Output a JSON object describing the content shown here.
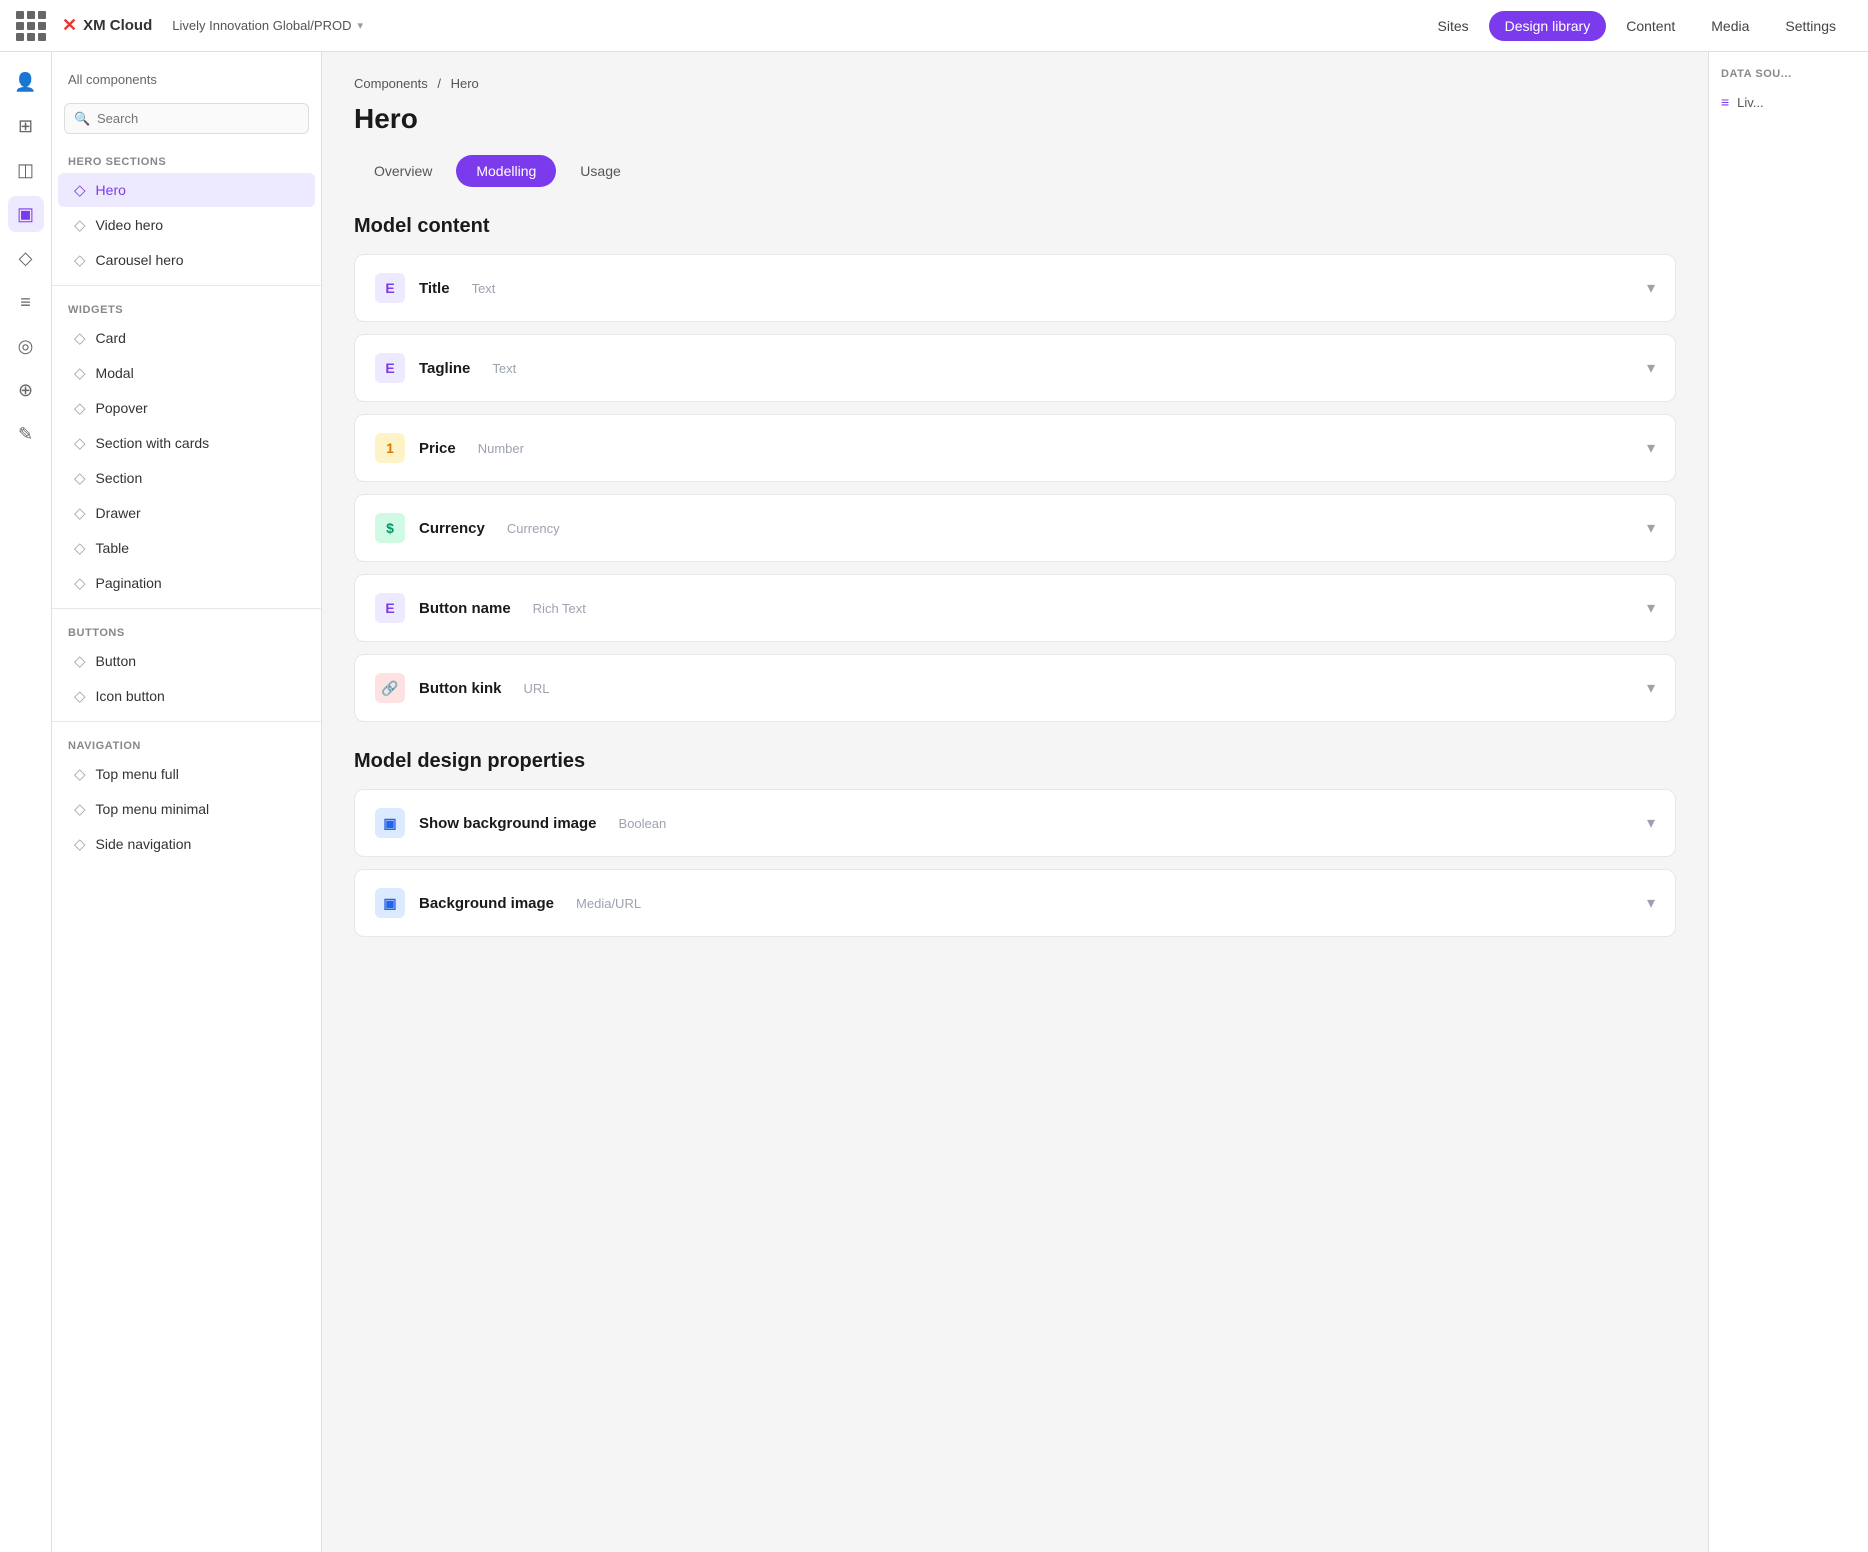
{
  "topnav": {
    "grid_label": "apps-grid",
    "logo_text": "XM Cloud",
    "brand": "Lively Innovation Global/PROD",
    "links": [
      {
        "label": "Sites",
        "active": false
      },
      {
        "label": "Design library",
        "active": true
      },
      {
        "label": "Content",
        "active": false
      },
      {
        "label": "Media",
        "active": false
      },
      {
        "label": "Settings",
        "active": false
      }
    ]
  },
  "icon_sidebar": {
    "items": [
      {
        "icon": "👤",
        "name": "profile-icon",
        "active": false
      },
      {
        "icon": "⊞",
        "name": "grid-icon",
        "active": false
      },
      {
        "icon": "◫",
        "name": "layout-icon",
        "active": false
      },
      {
        "icon": "▣",
        "name": "components-icon",
        "active": true
      },
      {
        "icon": "◇",
        "name": "diamond-icon",
        "active": false
      },
      {
        "icon": "≡",
        "name": "list-icon",
        "active": false
      },
      {
        "icon": "◎",
        "name": "globe-icon",
        "active": false
      },
      {
        "icon": "⊕",
        "name": "add-icon",
        "active": false
      },
      {
        "icon": "✎",
        "name": "edit-icon",
        "active": false
      }
    ]
  },
  "comp_sidebar": {
    "all_components_label": "All components",
    "search_placeholder": "Search",
    "sections": [
      {
        "label": "HERO SECTIONS",
        "items": [
          {
            "label": "Hero",
            "active": true
          },
          {
            "label": "Video hero",
            "active": false
          },
          {
            "label": "Carousel hero",
            "active": false
          }
        ]
      },
      {
        "label": "WIDGETS",
        "items": [
          {
            "label": "Card",
            "active": false
          },
          {
            "label": "Modal",
            "active": false
          },
          {
            "label": "Popover",
            "active": false
          },
          {
            "label": "Section with cards",
            "active": false
          },
          {
            "label": "Section",
            "active": false
          },
          {
            "label": "Drawer",
            "active": false
          },
          {
            "label": "Table",
            "active": false
          },
          {
            "label": "Pagination",
            "active": false
          }
        ]
      },
      {
        "label": "BUTTONS",
        "items": [
          {
            "label": "Button",
            "active": false
          },
          {
            "label": "Icon button",
            "active": false
          }
        ]
      },
      {
        "label": "NAVIGATION",
        "items": [
          {
            "label": "Top menu full",
            "active": false
          },
          {
            "label": "Top menu minimal",
            "active": false
          },
          {
            "label": "Side navigation",
            "active": false
          }
        ]
      }
    ]
  },
  "breadcrumb": {
    "parent": "Components",
    "current": "Hero"
  },
  "page_title": "Hero",
  "tabs": [
    {
      "label": "Overview",
      "active": false
    },
    {
      "label": "Modelling",
      "active": true
    },
    {
      "label": "Usage",
      "active": false
    }
  ],
  "model_content": {
    "title": "Model content",
    "fields": [
      {
        "id": "title-field",
        "icon": "E",
        "icon_style": "icon-text",
        "name": "Title",
        "type": "Text"
      },
      {
        "id": "tagline-field",
        "icon": "E",
        "icon_style": "icon-text",
        "name": "Tagline",
        "type": "Text"
      },
      {
        "id": "price-field",
        "icon": "1",
        "icon_style": "icon-number",
        "name": "Price",
        "type": "Number"
      },
      {
        "id": "currency-field",
        "icon": "$",
        "icon_style": "icon-currency",
        "name": "Currency",
        "type": "Currency"
      },
      {
        "id": "button-name-field",
        "icon": "E",
        "icon_style": "icon-text",
        "name": "Button name",
        "type": "Rich Text"
      },
      {
        "id": "button-kink-field",
        "icon": "🔗",
        "icon_style": "icon-link",
        "name": "Button kink",
        "type": "URL"
      }
    ]
  },
  "model_design": {
    "title": "Model design properties",
    "fields": [
      {
        "id": "show-bg-field",
        "icon": "▣",
        "icon_style": "icon-image",
        "name": "Show background image",
        "type": "Boolean"
      },
      {
        "id": "bg-image-field",
        "icon": "▣",
        "icon_style": "icon-image",
        "name": "Background image",
        "type": "Media/URL"
      }
    ]
  },
  "data_source": {
    "title": "Data sou...",
    "item_label": "Liv..."
  }
}
